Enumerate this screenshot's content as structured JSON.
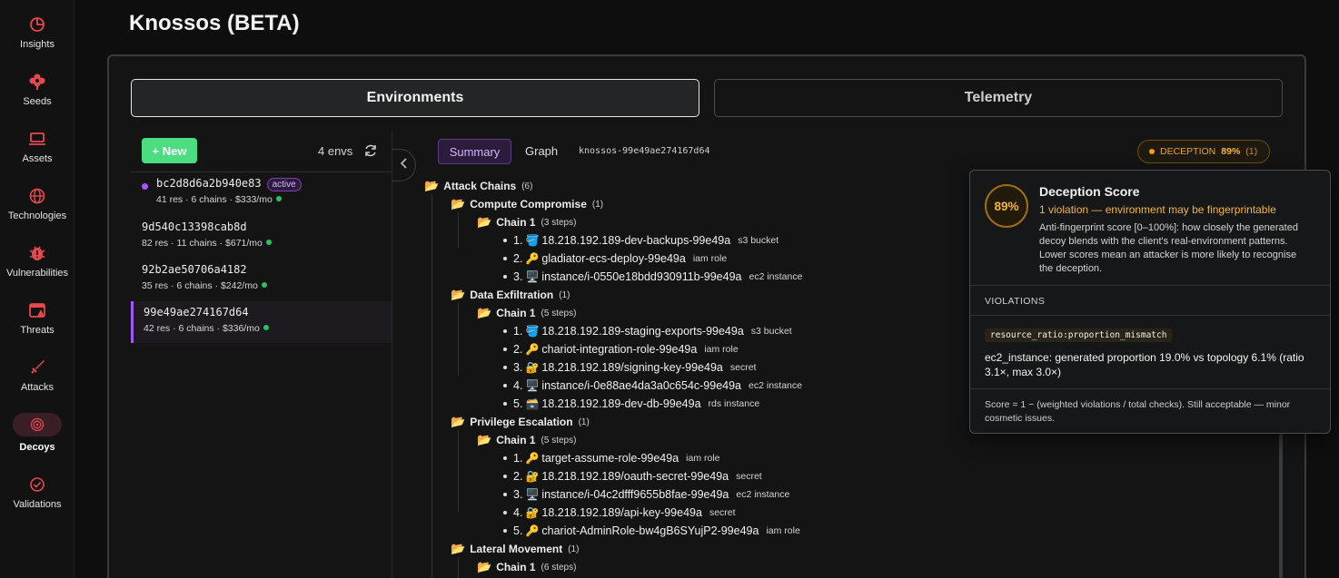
{
  "nav": {
    "items": [
      {
        "label": "Insights",
        "icon": "pie-chart-icon"
      },
      {
        "label": "Seeds",
        "icon": "flower-icon"
      },
      {
        "label": "Assets",
        "icon": "laptop-icon"
      },
      {
        "label": "Technologies",
        "icon": "globe-icon"
      },
      {
        "label": "Vulnerabilities",
        "icon": "bug-icon"
      },
      {
        "label": "Threats",
        "icon": "browser-alert-icon"
      },
      {
        "label": "Attacks",
        "icon": "sword-icon"
      },
      {
        "label": "Decoys",
        "icon": "radar-icon"
      },
      {
        "label": "Validations",
        "icon": "check-circle-icon"
      }
    ],
    "active": "Decoys",
    "accent": "#e5484d"
  },
  "page": {
    "title": "Knossos (BETA)"
  },
  "tabs": {
    "environments": "Environments",
    "telemetry": "Telemetry"
  },
  "envs": {
    "new_label": "+ New",
    "count_label": "4 envs",
    "items": [
      {
        "name": "bc2d8d6a2b940e83",
        "badge": "active",
        "meta": "41 res · 6 chains · $333/mo"
      },
      {
        "name": "9d540c13398cab8d",
        "meta": "82 res · 11 chains · $671/mo"
      },
      {
        "name": "92b2ae50706a4182",
        "meta": "35 res · 6 chains · $242/mo"
      },
      {
        "name": "99e49ae274167d64",
        "meta": "42 res · 6 chains · $336/mo"
      }
    ]
  },
  "detail": {
    "summary_tab": "Summary",
    "graph_tab": "Graph",
    "env_id": "knossos-99e49ae274167d64",
    "deception_label": "DECEPTION",
    "deception_value": "89%",
    "deception_count": "(1)"
  },
  "tree": {
    "root": {
      "label": "Attack Chains",
      "count": "(6)"
    },
    "groups": [
      {
        "label": "Compute Compromise",
        "count": "(1)",
        "chain": {
          "label": "Chain 1",
          "steps": "(3 steps)",
          "items": [
            {
              "n": "1.",
              "icon": "🪣",
              "name": "18.218.192.189-dev-backups-99e49a",
              "type": "s3 bucket"
            },
            {
              "n": "2.",
              "icon": "🔑",
              "name": "gladiator-ecs-deploy-99e49a",
              "type": "iam role"
            },
            {
              "n": "3.",
              "icon": "🖥️",
              "name": "instance/i-0550e18bdd930911b-99e49a",
              "type": "ec2 instance"
            }
          ]
        }
      },
      {
        "label": "Data Exfiltration",
        "count": "(1)",
        "chain": {
          "label": "Chain 1",
          "steps": "(5 steps)",
          "items": [
            {
              "n": "1.",
              "icon": "🪣",
              "name": "18.218.192.189-staging-exports-99e49a",
              "type": "s3 bucket"
            },
            {
              "n": "2.",
              "icon": "🔑",
              "name": "chariot-integration-role-99e49a",
              "type": "iam role"
            },
            {
              "n": "3.",
              "icon": "🔐",
              "name": "18.218.192.189/signing-key-99e49a",
              "type": "secret"
            },
            {
              "n": "4.",
              "icon": "🖥️",
              "name": "instance/i-0e88ae4da3a0c654c-99e49a",
              "type": "ec2 instance"
            },
            {
              "n": "5.",
              "icon": "🗃️",
              "name": "18.218.192.189-dev-db-99e49a",
              "type": "rds instance"
            }
          ]
        }
      },
      {
        "label": "Privilege Escalation",
        "count": "(1)",
        "chain": {
          "label": "Chain 1",
          "steps": "(5 steps)",
          "items": [
            {
              "n": "1.",
              "icon": "🔑",
              "name": "target-assume-role-99e49a",
              "type": "iam role"
            },
            {
              "n": "2.",
              "icon": "🔐",
              "name": "18.218.192.189/oauth-secret-99e49a",
              "type": "secret"
            },
            {
              "n": "3.",
              "icon": "🖥️",
              "name": "instance/i-04c2dfff9655b8fae-99e49a",
              "type": "ec2 instance"
            },
            {
              "n": "4.",
              "icon": "🔐",
              "name": "18.218.192.189/api-key-99e49a",
              "type": "secret"
            },
            {
              "n": "5.",
              "icon": "🔑",
              "name": "chariot-AdminRole-bw4gB6SYujP2-99e49a",
              "type": "iam role"
            }
          ]
        }
      },
      {
        "label": "Lateral Movement",
        "count": "(1)",
        "chain": {
          "label": "Chain 1",
          "steps": "(6 steps)",
          "items": []
        }
      }
    ]
  },
  "popover": {
    "score": "89%",
    "title": "Deception Score",
    "subtitle": "1 violation — environment may be fingerprintable",
    "description": "Anti-fingerprint score [0–100%]: how closely the generated decoy blends with the client's real-environment patterns. Lower scores mean an attacker is more likely to recognise the deception.",
    "violations_header": "VIOLATIONS",
    "violation_code": "resource_ratio:proportion_mismatch",
    "violation_text": "ec2_instance: generated proportion 19.0% vs topology 6.1% (ratio 3.1×, max 3.0×)",
    "footer": "Score = 1 − (weighted violations / total checks). Still acceptable — minor cosmetic issues."
  }
}
